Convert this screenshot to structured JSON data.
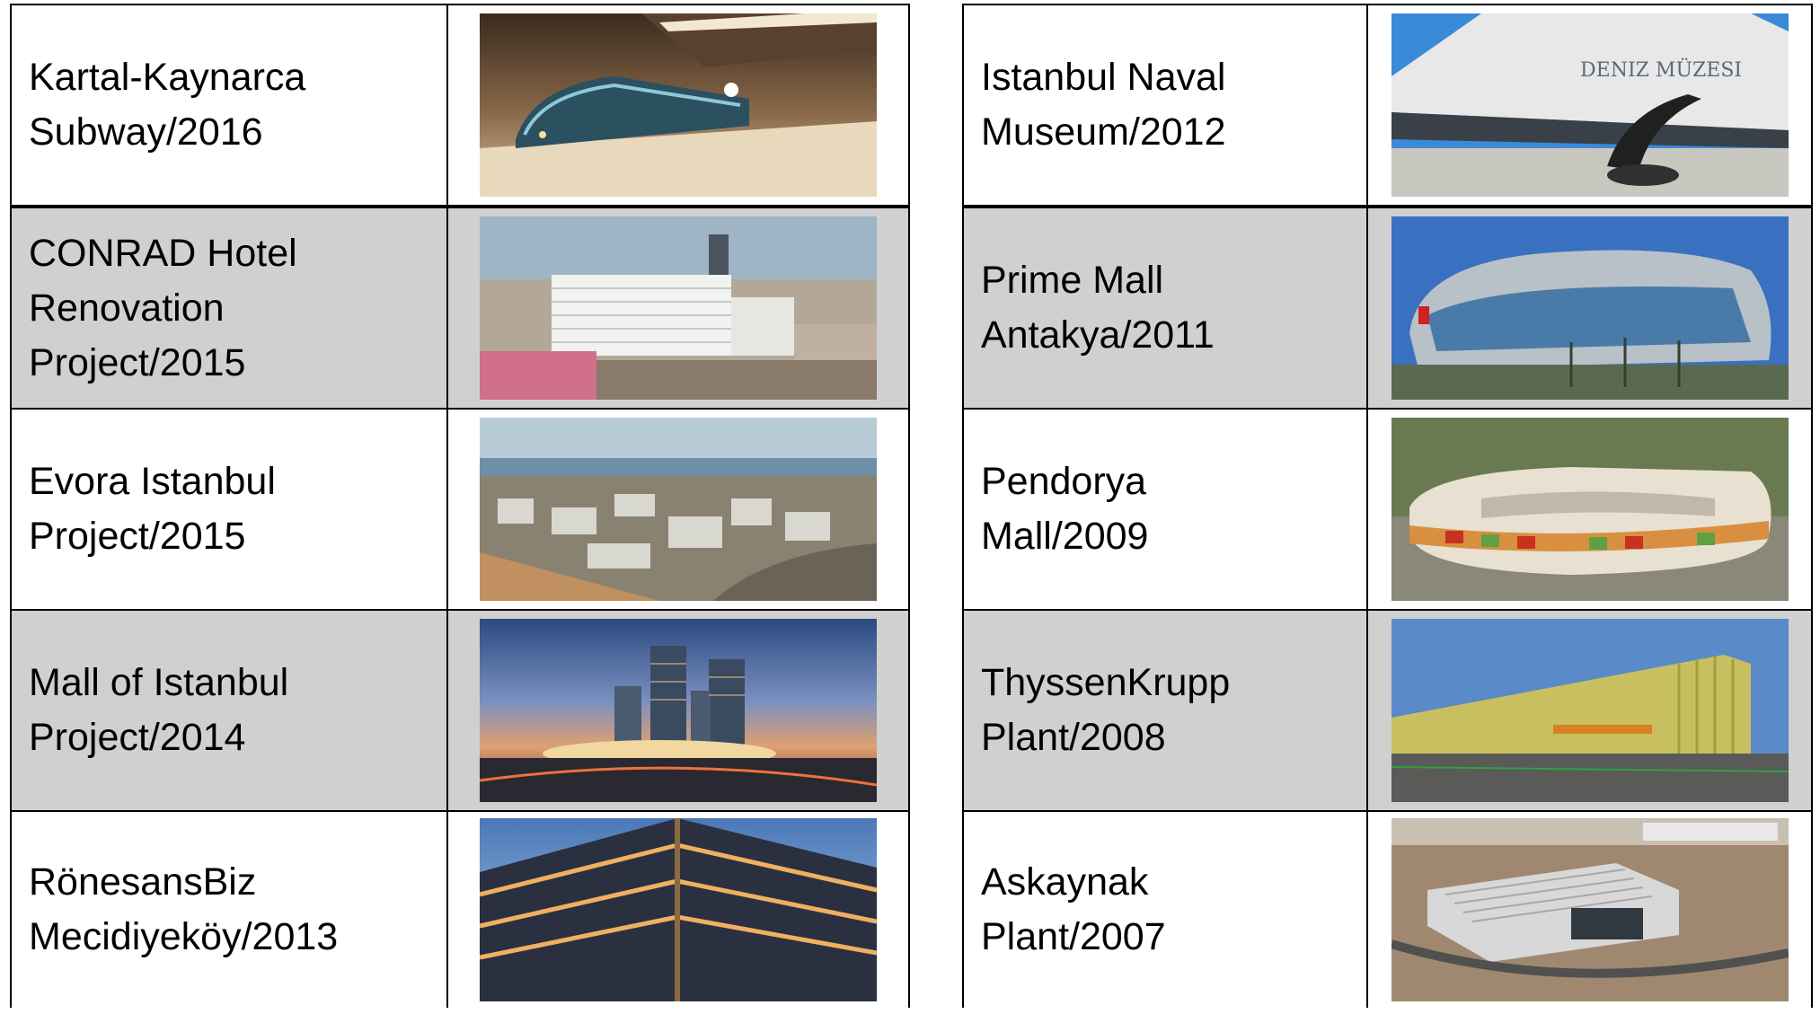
{
  "tables": {
    "left": [
      {
        "label": "Kartal-Kaynarca\nSubway/2016",
        "photo": "subway-station-photo"
      },
      {
        "label": "CONRAD Hotel\nRenovation\nProject/2015",
        "photo": "hotel-photo"
      },
      {
        "label": "Evora Istanbul\nProject/2015",
        "photo": "residential-complex-photo"
      },
      {
        "label": "Mall of Istanbul\nProject/2014",
        "photo": "mall-towers-photo"
      },
      {
        "label": "RönesansBiz\nMecidiyeköy/2013",
        "photo": "office-building-photo"
      }
    ],
    "right": [
      {
        "label": "Istanbul Naval\nMuseum/2012",
        "photo": "naval-museum-photo"
      },
      {
        "label": "Prime Mall\nAntakya/2011",
        "photo": "prime-mall-photo"
      },
      {
        "label": "Pendorya\nMall/2009",
        "photo": "pendorya-mall-photo"
      },
      {
        "label": "ThyssenKrupp\nPlant/2008",
        "photo": "factory-plant-photo"
      },
      {
        "label": "Askaynak\nPlant/2007",
        "photo": "industrial-plant-photo"
      }
    ]
  },
  "colors": {
    "row_alt_bg": "#d0d0d0",
    "border": "#000000"
  }
}
